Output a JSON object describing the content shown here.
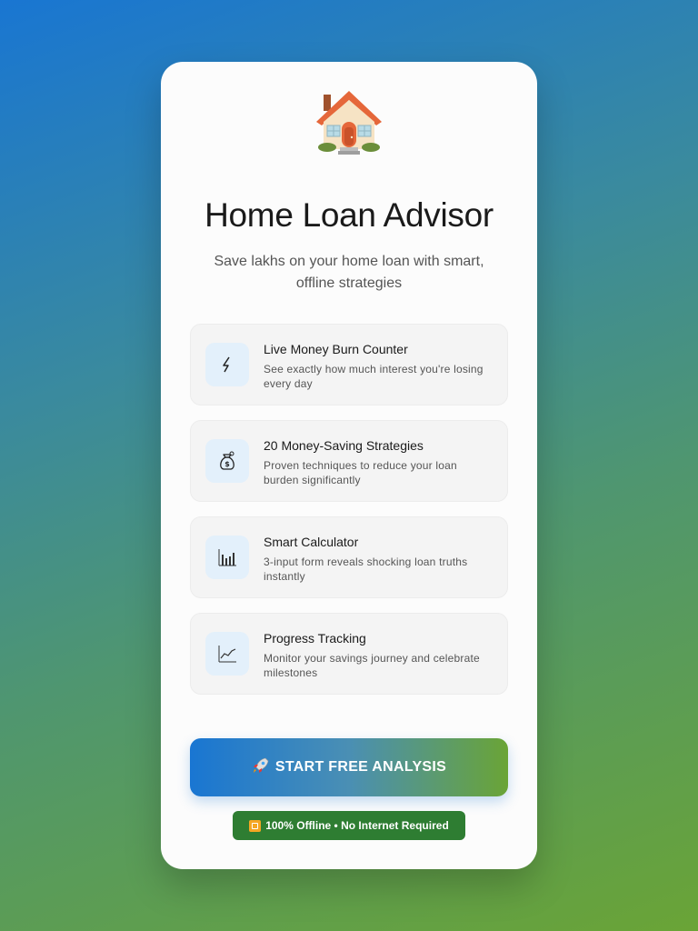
{
  "app": {
    "title": "Home Loan Advisor",
    "subtitle": "Save lakhs on your home loan with smart, offline strategies",
    "logo_icon": "house-icon"
  },
  "features": [
    {
      "icon": "lightning-icon",
      "title": "Live Money Burn Counter",
      "description": "See exactly how much interest you're losing every day"
    },
    {
      "icon": "money-bag-icon",
      "title": "20 Money-Saving Strategies",
      "description": "Proven techniques to reduce your loan burden significantly"
    },
    {
      "icon": "bar-chart-icon",
      "title": "Smart Calculator",
      "description": "3-input form reveals shocking loan truths instantly"
    },
    {
      "icon": "line-chart-icon",
      "title": "Progress Tracking",
      "description": "Monitor your savings journey and celebrate milestones"
    }
  ],
  "cta": {
    "icon": "rocket-icon",
    "label": "START FREE ANALYSIS"
  },
  "badge": {
    "icon": "offline-icon",
    "label": "100% Offline • No Internet Required"
  },
  "colors": {
    "primary_blue": "#1976d2",
    "primary_green": "#6aa436",
    "badge_green": "#2e7d32",
    "icon_bg": "#e3f0fb"
  }
}
